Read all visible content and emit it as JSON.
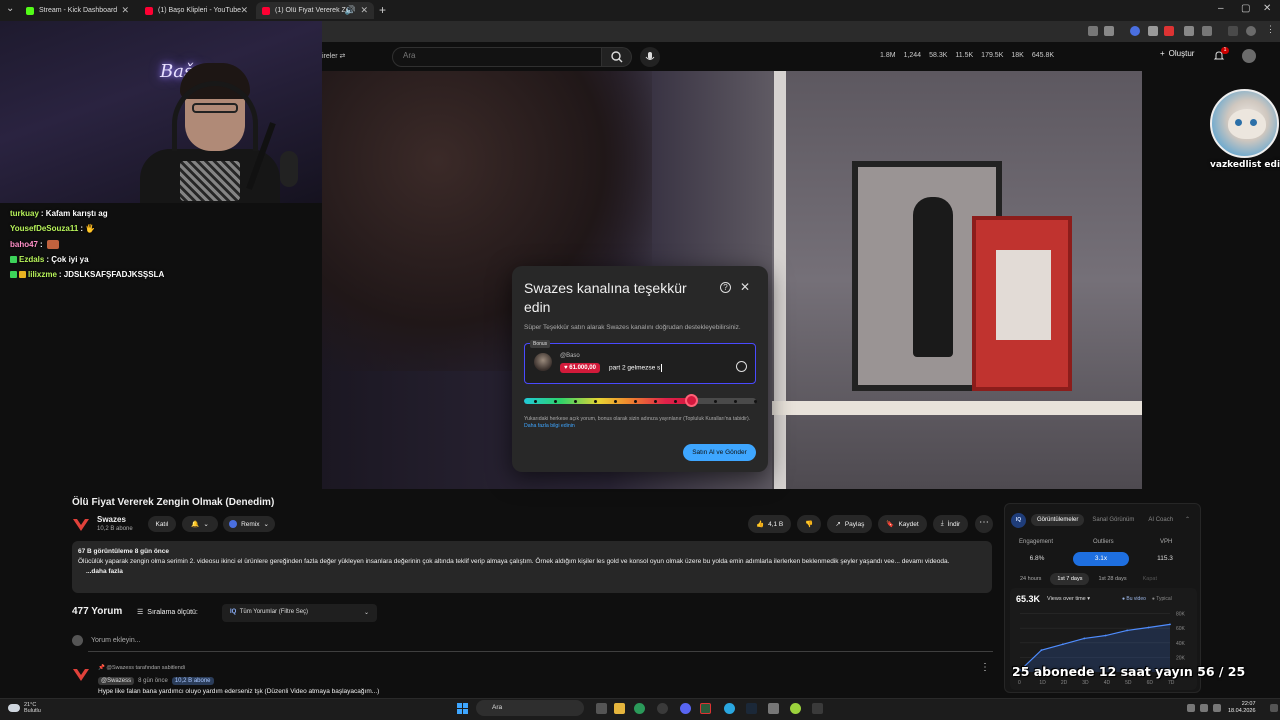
{
  "browser": {
    "tabs": [
      {
        "label": "Stream - Kick Dashboard",
        "active": false,
        "favicon_color": "#53fc18"
      },
      {
        "label": "(1) Başo Klipleri - YouTube",
        "active": false,
        "favicon_color": "#ff0033"
      },
      {
        "label": "(1) Ölü Fiyat Vererek Zengin",
        "active": true,
        "favicon_color": "#ff0033"
      }
    ]
  },
  "youtube": {
    "search_placeholder": "Ara",
    "filter_label": "ireler",
    "stats": [
      "1.8M",
      "1,244",
      "58.3K",
      "11.5K",
      "179.5K",
      "18K",
      "645.8K"
    ],
    "create_label": "Oluştur",
    "notification_count": "1"
  },
  "chat": [
    {
      "user": "turkuay",
      "color": "#b7f35a",
      "message": ": Kafam karıştı ag",
      "badge": ""
    },
    {
      "user": "YousefDeSouza11",
      "color": "#b7f35a",
      "message": ": 🖐",
      "badge": ""
    },
    {
      "user": "baho47",
      "color": "#ff8fc8",
      "message": ": ",
      "badge": "",
      "emote": true
    },
    {
      "user": "Ezdals",
      "color": "#b7f35a",
      "message": ": Çok iyi ya",
      "badge": "#3cd35a"
    },
    {
      "user": "lilixzme",
      "color": "#b7f35a",
      "message": ": JDSLKSAFŞFADJKSŞSLA",
      "badge": "#3cd35a"
    }
  ],
  "dialog": {
    "title": "Swazes kanalına teşekkür edin",
    "description": "Süper Teşekkür satın alarak Swazes kanalını doğrudan destekleyebilirsiniz.",
    "bonus_label": "Bonus",
    "username": "@Baso",
    "amount": "♥ 61.000,00",
    "message": "part 2 gelmezse s",
    "slider_percent": 72,
    "note": "Yukarıdaki herkese açık yorum, bonus olarak sizin adınıza yayınlanır (Topluluk Kuralları'na tabidir).",
    "note_link": "Daha fazla bilgi edinin",
    "buy_button": "Satın Al ve Gönder"
  },
  "overlay": {
    "cat_label": "vazkedlist edin",
    "goal_text": "25 abonede 12 saat yayın 56 / 25"
  },
  "video": {
    "title": "Ölü Fiyat Vererek Zengin Olmak (Denedim)",
    "channel": "Swazes",
    "subscribers": "10,2 B abone",
    "join_label": "Katıl",
    "remix_label": "Remix",
    "likes": "4,1 B",
    "share_label": "Paylaş",
    "save_label": "Kaydet",
    "download_label": "İndir",
    "description_meta": "67 B görüntüleme  8 gün önce",
    "description_text": "Ölücülük yaparak zengin olma serimin 2. videosu ikinci el ürünlere gereğinden fazla değer yükleyen insanlara değerinin çok altında teklif verip almaya çalıştım. Örnek aldığım kişiler les gold ve konsol oyun olmak üzere bu yolda emin adımlarla ilerlerken beklenmedik şeyler yaşandı vee... devamı videoda.",
    "description_more": "...daha fazla"
  },
  "comments": {
    "count": "477 Yorum",
    "sort_label": "Sıralama ölçütü:",
    "filter_label": "Tüm Yorumlar (Filtre Seç)",
    "add_placeholder": "Yorum ekleyin...",
    "pinned": "@Swazess tarafından sabitlendi",
    "first": {
      "user": "@Swazess",
      "time": "8 gün önce",
      "subs": "10,2 B abone",
      "text": "Hype like falan bana yardımcı oluyo yardım ederseniz tşk (Düzenli Video atmaya başlayacağım...)"
    }
  },
  "analytics": {
    "tabs": [
      "Görüntülemeler",
      "Sanal Görünüm",
      "AI Coach"
    ],
    "active_tab": 0,
    "metrics": [
      {
        "label": "Engagement",
        "value": "6.8%",
        "active": false
      },
      {
        "label": "Outliers",
        "value": "3.1x",
        "active": true
      },
      {
        "label": "VPH",
        "value": "115.3",
        "active": false
      }
    ],
    "ranges": [
      "24 hours",
      "1st 7 days",
      "1st 28 days",
      "Kapat"
    ],
    "active_range": 1,
    "big_value": "65.3K",
    "metric_select": "Views over time ▾",
    "legend": [
      "Bu video",
      "Typical"
    ]
  },
  "chart_data": {
    "type": "line",
    "title": "Views over time",
    "x": [
      0,
      1,
      2,
      3,
      4,
      5,
      6,
      7
    ],
    "xticks": [
      "0",
      "1D",
      "2D",
      "3D",
      "4D",
      "5D",
      "6D",
      "7D"
    ],
    "yticks": [
      "80K",
      "60K",
      "40K",
      "20K"
    ],
    "ylim": [
      0,
      85000
    ],
    "series": [
      {
        "name": "Bu video",
        "values": [
          2000,
          30000,
          38000,
          46000,
          50000,
          57000,
          61000,
          65300
        ]
      }
    ],
    "grid": true,
    "legend_position": "top-right"
  },
  "taskbar": {
    "weather_temp": "21°C",
    "weather_desc": "Bulutlu",
    "search_label": "Ara",
    "time": "22:07",
    "date": "18.04.2026"
  }
}
